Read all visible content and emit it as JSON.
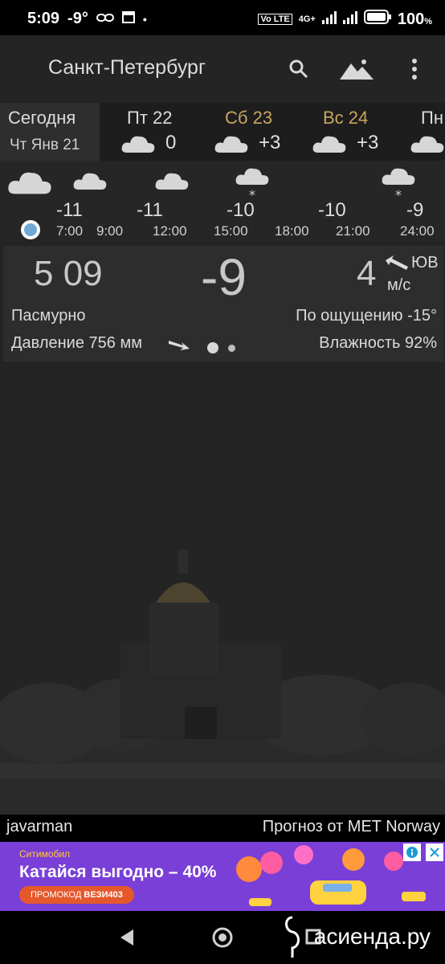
{
  "status_bar": {
    "time": "5:09",
    "weather_temp": "-9°",
    "network": "4G+",
    "volte": "Vo LTE",
    "battery": "100",
    "battery_unit": "%"
  },
  "app_bar": {
    "city": "Санкт-Петербург",
    "icons": [
      "search-icon",
      "landscape-icon",
      "more-vert-icon"
    ]
  },
  "days": [
    {
      "name": "Сегодня",
      "sub": "Чт Янв 21",
      "temp": "",
      "weekend": false
    },
    {
      "name": "Пт 22",
      "sub": "",
      "temp": "0",
      "weekend": false
    },
    {
      "name": "Сб 23",
      "sub": "",
      "temp": "+3",
      "weekend": true
    },
    {
      "name": "Вс 24",
      "sub": "",
      "temp": "+3",
      "weekend": true
    },
    {
      "name": "Пн",
      "sub": "",
      "temp": "",
      "weekend": false
    }
  ],
  "hourly": {
    "temps": [
      "-11",
      "-11",
      "-10",
      "-10",
      "-9"
    ],
    "hours": [
      "7:00",
      "9:00",
      "12:00",
      "15:00",
      "18:00",
      "21:00",
      "24:00"
    ]
  },
  "current": {
    "time": "5 09",
    "temp": "-9",
    "wind_speed": "4",
    "wind_dir": "ЮВ",
    "wind_unit": "м/с",
    "condition": "Пасмурно",
    "feels_like": "По ощущению -15°",
    "pressure": "Давление 756 мм",
    "humidity": "Влажность 92%"
  },
  "footer": {
    "author": "javarman",
    "provider": "Прогноз от MET Norway"
  },
  "ad": {
    "brand": "Ситимобил",
    "headline": "Катайся выгодно – 40%",
    "promo_label": "ПРОМОКОД",
    "promo_code": "ВЕЗИ403"
  },
  "watermark": "асиенда.ру",
  "colors": {
    "weekend": "#c9a660",
    "ad_bg": "#7a3fd6",
    "promo_bg": "#e5582b",
    "now_dot": "#6fa9d6"
  }
}
